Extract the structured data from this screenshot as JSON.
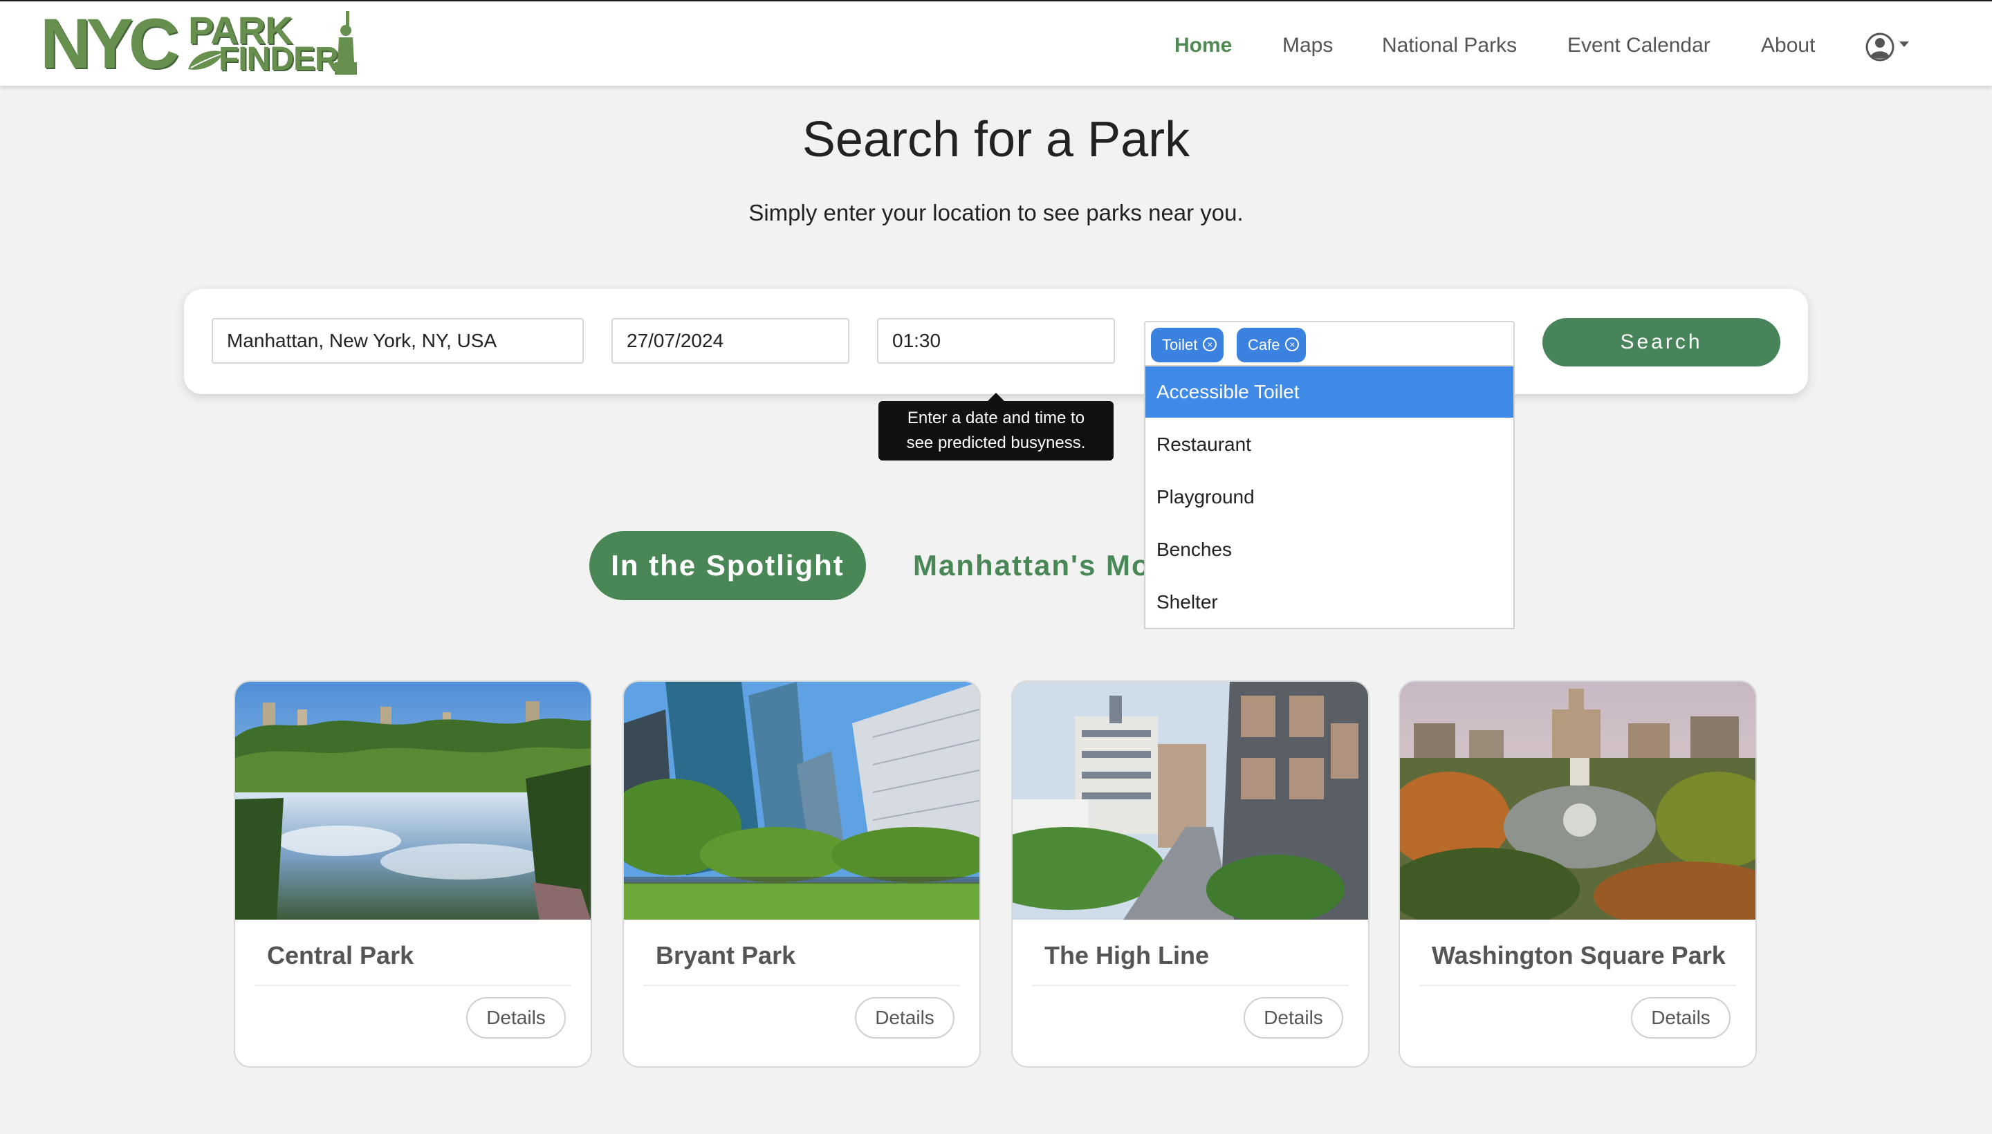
{
  "header": {
    "logo": {
      "nyc": "NYC",
      "park": "PARK",
      "finder": "FINDER"
    },
    "nav": [
      {
        "label": "Home",
        "active": true
      },
      {
        "label": "Maps"
      },
      {
        "label": "National Parks"
      },
      {
        "label": "Event Calendar"
      },
      {
        "label": "About"
      }
    ],
    "user_icon": "user-circle-icon"
  },
  "hero": {
    "title": "Search for a Park",
    "subtitle": "Simply enter your location to see parks near you."
  },
  "search": {
    "location": "Manhattan, New York, NY, USA",
    "date": "27/07/2024",
    "time": "01:30",
    "tags": [
      "Toilet",
      "Cafe"
    ],
    "button_label": "Search",
    "tooltip_line1": "Enter a date and time to",
    "tooltip_line2": "see predicted busyness.",
    "dropdown_options": [
      "Accessible Toilet",
      "Restaurant",
      "Playground",
      "Benches",
      "Shelter"
    ]
  },
  "tabs": {
    "spotlight": "In the Spotlight",
    "busiest": "Manhattan's Most Busy"
  },
  "cards": [
    {
      "title": "Central Park",
      "button": "Details",
      "image": "lake-with-trees-and-skyline"
    },
    {
      "title": "Bryant Park",
      "button": "Details",
      "image": "skyscrapers-over-park-lawn"
    },
    {
      "title": "The High Line",
      "button": "Details",
      "image": "elevated-walkway-between-buildings"
    },
    {
      "title": "Washington Square Park",
      "button": "Details",
      "image": "autumn-park-aerial-view"
    }
  ],
  "colors": {
    "brand_green": "#4a8757",
    "tag_blue": "#3b82e0",
    "highlight_blue": "#3e8ae6",
    "background": "#f2f2f2"
  }
}
